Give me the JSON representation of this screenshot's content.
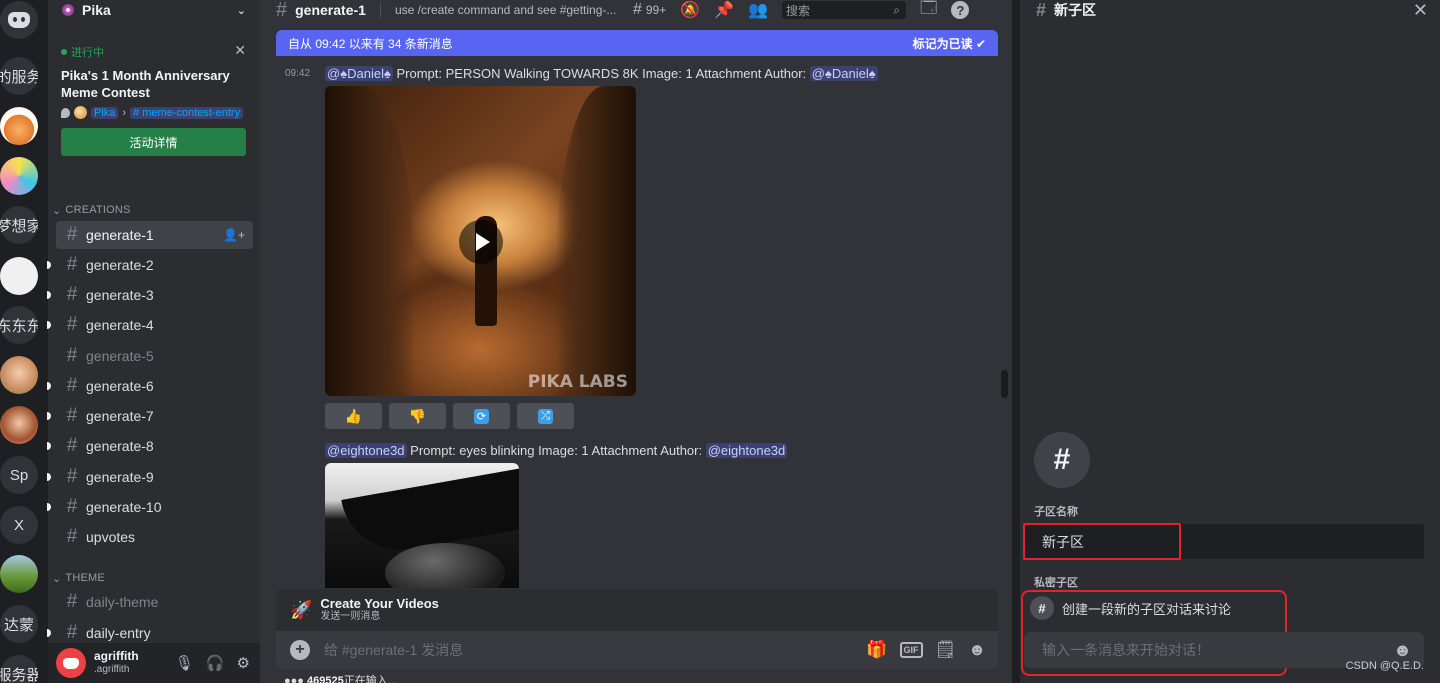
{
  "rail": {
    "servers": [
      {
        "label": "",
        "kind": "discord-home"
      },
      {
        "label": "的服务",
        "kind": "text"
      },
      {
        "label": "",
        "kind": "fox-avatar"
      },
      {
        "label": "",
        "kind": "color-avatar"
      },
      {
        "label": "梦想家",
        "kind": "text"
      },
      {
        "label": "",
        "kind": "sketch-avatar"
      },
      {
        "label": "东东东",
        "kind": "text"
      },
      {
        "label": "",
        "kind": "child-avatar"
      },
      {
        "label": "",
        "kind": "girl-avatar"
      },
      {
        "label": "Sp",
        "kind": "text"
      },
      {
        "label": "X",
        "kind": "text"
      },
      {
        "label": "",
        "kind": "landscape-avatar"
      },
      {
        "label": "达蒙",
        "kind": "text"
      },
      {
        "label": "服务器",
        "kind": "text"
      }
    ]
  },
  "sidebar": {
    "server_name": "Pika",
    "event": {
      "status": "进行中",
      "title": "Pika's 1 Month Anniversary Meme Contest",
      "location_server": "Pika",
      "location_channel": "meme-contest-entry",
      "button": "活动详情"
    },
    "categories": {
      "creations": "CREATIONS",
      "theme": "THEME"
    },
    "channels": [
      {
        "name": "generate-1",
        "state": "active"
      },
      {
        "name": "generate-2",
        "state": "unread"
      },
      {
        "name": "generate-3",
        "state": "unread"
      },
      {
        "name": "generate-4",
        "state": "unread"
      },
      {
        "name": "generate-5",
        "state": "muted"
      },
      {
        "name": "generate-6",
        "state": "unread"
      },
      {
        "name": "generate-7",
        "state": "unread"
      },
      {
        "name": "generate-8",
        "state": "unread"
      },
      {
        "name": "generate-9",
        "state": "unread"
      },
      {
        "name": "generate-10",
        "state": "unread"
      },
      {
        "name": "upvotes",
        "state": "normal"
      }
    ],
    "theme_channels": [
      {
        "name": "daily-theme",
        "state": "muted"
      },
      {
        "name": "daily-entry",
        "state": "unread"
      }
    ],
    "user": {
      "name": "agriffith",
      "tag": ".agriffith"
    }
  },
  "chat": {
    "channel": "generate-1",
    "topic": "use /create command and see #getting-...",
    "mentions_count": "99+",
    "search_placeholder": "搜索",
    "new_messages": "自从 09:42 以来有 34 条新消息",
    "mark_read": "标记为已读",
    "messages": [
      {
        "time": "09:42",
        "mention": "@♠Daniel♠",
        "text": "Prompt: PERSON Walking TOWARDS 8K  Image: 1 Attachment  Author:",
        "author": "@♠Daniel♠",
        "watermark": "PIKA LABS"
      },
      {
        "time": "",
        "mention": "@eightone3d",
        "text": "Prompt: eyes blinking  Image: 1 Attachment  Author:",
        "author": "@eightone3d"
      }
    ],
    "reaction_buttons": [
      "👍",
      "👎",
      "🔄",
      "🔀"
    ],
    "embed_title": "Create Your Videos",
    "embed_sub": "发送一则消息",
    "composer_placeholder": "给 #generate-1 发消息",
    "typing_user": "469525",
    "typing_text": "正在输入..."
  },
  "thread": {
    "title": "新子区",
    "name_label": "子区名称",
    "name_value": "新子区",
    "private_label": "私密子区",
    "starter_text": "创建一段新的子区对话来讨论",
    "input_placeholder": "输入一条消息来开始对话！"
  },
  "credit": "CSDN @Q.E.D.",
  "colors": {
    "accent": "#5865f2",
    "green": "#248046",
    "highlight": "#e0242c"
  }
}
